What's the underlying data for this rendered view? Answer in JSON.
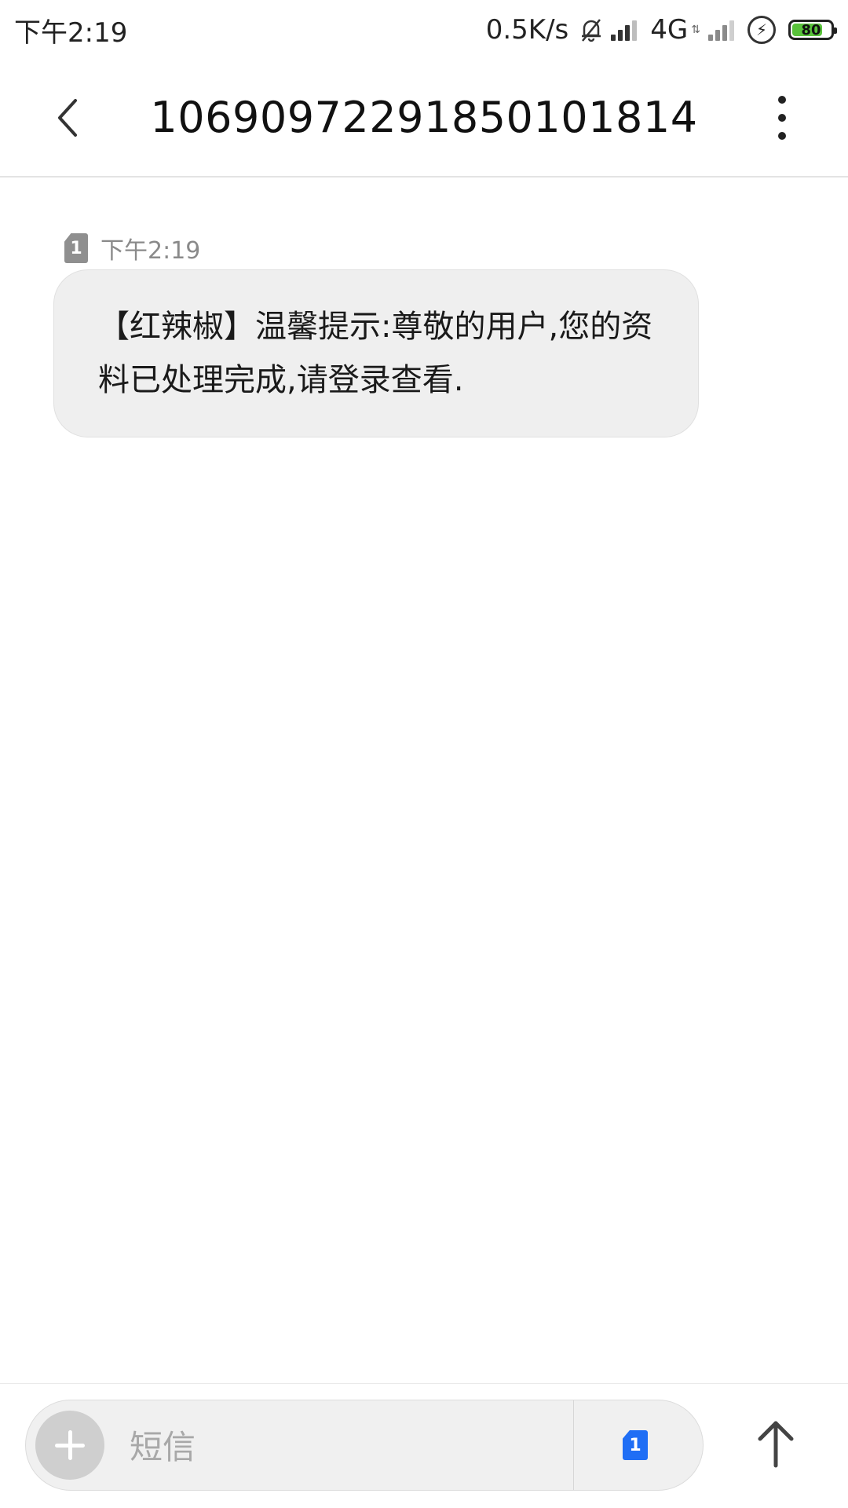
{
  "status_bar": {
    "time": "下午2:19",
    "net_speed": "0.5K/s",
    "network_type": "4G",
    "network_arrows": "⇅",
    "battery_level": "80",
    "battery_percent": 80
  },
  "header": {
    "title": "1069097229185010181 4"
  },
  "message": {
    "sim": "1",
    "time": "下午2:19",
    "text": "【红辣椒】温馨提示:尊敬的用户,您的资料已处理完成,请登录查看."
  },
  "compose": {
    "placeholder": "短信",
    "sim": "1"
  },
  "colors": {
    "bubble": "#efefef",
    "sim_active": "#1f6ef5",
    "battery_fill": "#59c23b"
  }
}
